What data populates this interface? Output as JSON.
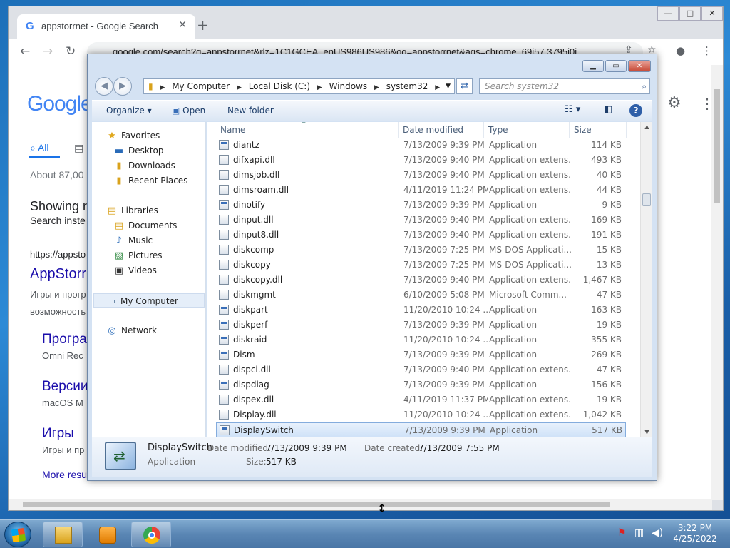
{
  "chrome": {
    "tab_title": "appstorrnet - Google Search",
    "url": "google.com/search?q=appstorrnet&rlz=1C1GCEA_enUS986US986&oq=appstorrnet&aqs=chrome..69i57.3795j0j",
    "page": {
      "logo": "Google",
      "tab_all": "All",
      "about": "About 87,00",
      "showing": "Showing r",
      "search_instead": "Search inste",
      "result_url": "https://appsto",
      "result_title": "AppStorr",
      "result_desc1": "Игры и прогр",
      "result_desc2": "возможность",
      "sub1_title": "Програ",
      "sub1_desc": "Omni Rec",
      "sub2_title": "Версии",
      "sub2_desc": "macOS M",
      "sub3_title": "Игры",
      "sub3_desc": "Игры и пр",
      "more": "More resu"
    }
  },
  "explorer": {
    "breadcrumb": [
      "My Computer",
      "Local Disk (C:)",
      "Windows",
      "system32"
    ],
    "search_placeholder": "Search system32",
    "toolbar": {
      "organize": "Organize ▾",
      "open": "Open",
      "new_folder": "New folder"
    },
    "nav": {
      "favorites": "Favorites",
      "desktop": "Desktop",
      "downloads": "Downloads",
      "recent": "Recent Places",
      "libraries": "Libraries",
      "documents": "Documents",
      "music": "Music",
      "pictures": "Pictures",
      "videos": "Videos",
      "mycomputer": "My Computer",
      "network": "Network"
    },
    "columns": {
      "name": "Name",
      "date": "Date modified",
      "type": "Type",
      "size": "Size"
    },
    "files": [
      {
        "name": "diantz",
        "date": "7/13/2009 9:39 PM",
        "type": "Application",
        "size": "114 KB"
      },
      {
        "name": "difxapi.dll",
        "date": "7/13/2009 9:40 PM",
        "type": "Application extens...",
        "size": "493 KB"
      },
      {
        "name": "dimsjob.dll",
        "date": "7/13/2009 9:40 PM",
        "type": "Application extens...",
        "size": "40 KB"
      },
      {
        "name": "dimsroam.dll",
        "date": "4/11/2019 11:24 PM",
        "type": "Application extens...",
        "size": "44 KB"
      },
      {
        "name": "dinotify",
        "date": "7/13/2009 9:39 PM",
        "type": "Application",
        "size": "9 KB"
      },
      {
        "name": "dinput.dll",
        "date": "7/13/2009 9:40 PM",
        "type": "Application extens...",
        "size": "169 KB"
      },
      {
        "name": "dinput8.dll",
        "date": "7/13/2009 9:40 PM",
        "type": "Application extens...",
        "size": "191 KB"
      },
      {
        "name": "diskcomp",
        "date": "7/13/2009 7:25 PM",
        "type": "MS-DOS Applicati...",
        "size": "15 KB"
      },
      {
        "name": "diskcopy",
        "date": "7/13/2009 7:25 PM",
        "type": "MS-DOS Applicati...",
        "size": "13 KB"
      },
      {
        "name": "diskcopy.dll",
        "date": "7/13/2009 9:40 PM",
        "type": "Application extens...",
        "size": "1,467 KB"
      },
      {
        "name": "diskmgmt",
        "date": "6/10/2009 5:08 PM",
        "type": "Microsoft Comm...",
        "size": "47 KB"
      },
      {
        "name": "diskpart",
        "date": "11/20/2010 10:24 ...",
        "type": "Application",
        "size": "163 KB"
      },
      {
        "name": "diskperf",
        "date": "7/13/2009 9:39 PM",
        "type": "Application",
        "size": "19 KB"
      },
      {
        "name": "diskraid",
        "date": "11/20/2010 10:24 ...",
        "type": "Application",
        "size": "355 KB"
      },
      {
        "name": "Dism",
        "date": "7/13/2009 9:39 PM",
        "type": "Application",
        "size": "269 KB"
      },
      {
        "name": "dispci.dll",
        "date": "7/13/2009 9:40 PM",
        "type": "Application extens...",
        "size": "47 KB"
      },
      {
        "name": "dispdiag",
        "date": "7/13/2009 9:39 PM",
        "type": "Application",
        "size": "156 KB"
      },
      {
        "name": "dispex.dll",
        "date": "4/11/2019 11:37 PM",
        "type": "Application extens...",
        "size": "19 KB"
      },
      {
        "name": "Display.dll",
        "date": "11/20/2010 10:24 ...",
        "type": "Application extens...",
        "size": "1,042 KB"
      },
      {
        "name": "DisplaySwitch",
        "date": "7/13/2009 9:39 PM",
        "type": "Application",
        "size": "517 KB"
      }
    ],
    "details": {
      "name": "DisplaySwitch",
      "type": "Application",
      "date_modified_label": "Date modified:",
      "date_modified": "7/13/2009 9:39 PM",
      "date_created_label": "Date created:",
      "date_created": "7/13/2009 7:55 PM",
      "size_label": "Size:",
      "size": "517 KB"
    }
  },
  "taskbar": {
    "time": "3:22 PM",
    "date": "4/25/2022"
  }
}
